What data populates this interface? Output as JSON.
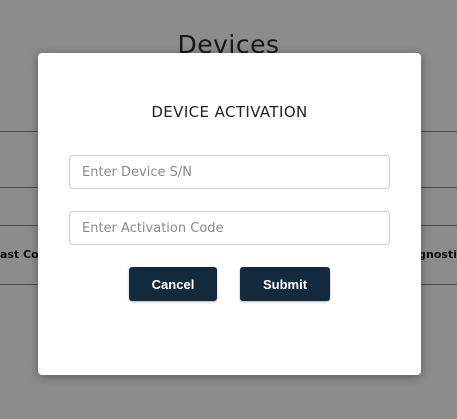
{
  "background": {
    "page_title": "Devices",
    "table_header_left": "ast Co",
    "table_header_right": "gnosti"
  },
  "modal": {
    "title": "DEVICE ACTIVATION",
    "serial_field": {
      "placeholder": "Enter Device S/N",
      "value": ""
    },
    "activation_field": {
      "placeholder": "Enter Activation Code",
      "value": ""
    },
    "cancel_label": "Cancel",
    "submit_label": "Submit"
  },
  "colors": {
    "button_bg": "#13293d",
    "overlay": "rgba(0,0,0,0.45)"
  }
}
